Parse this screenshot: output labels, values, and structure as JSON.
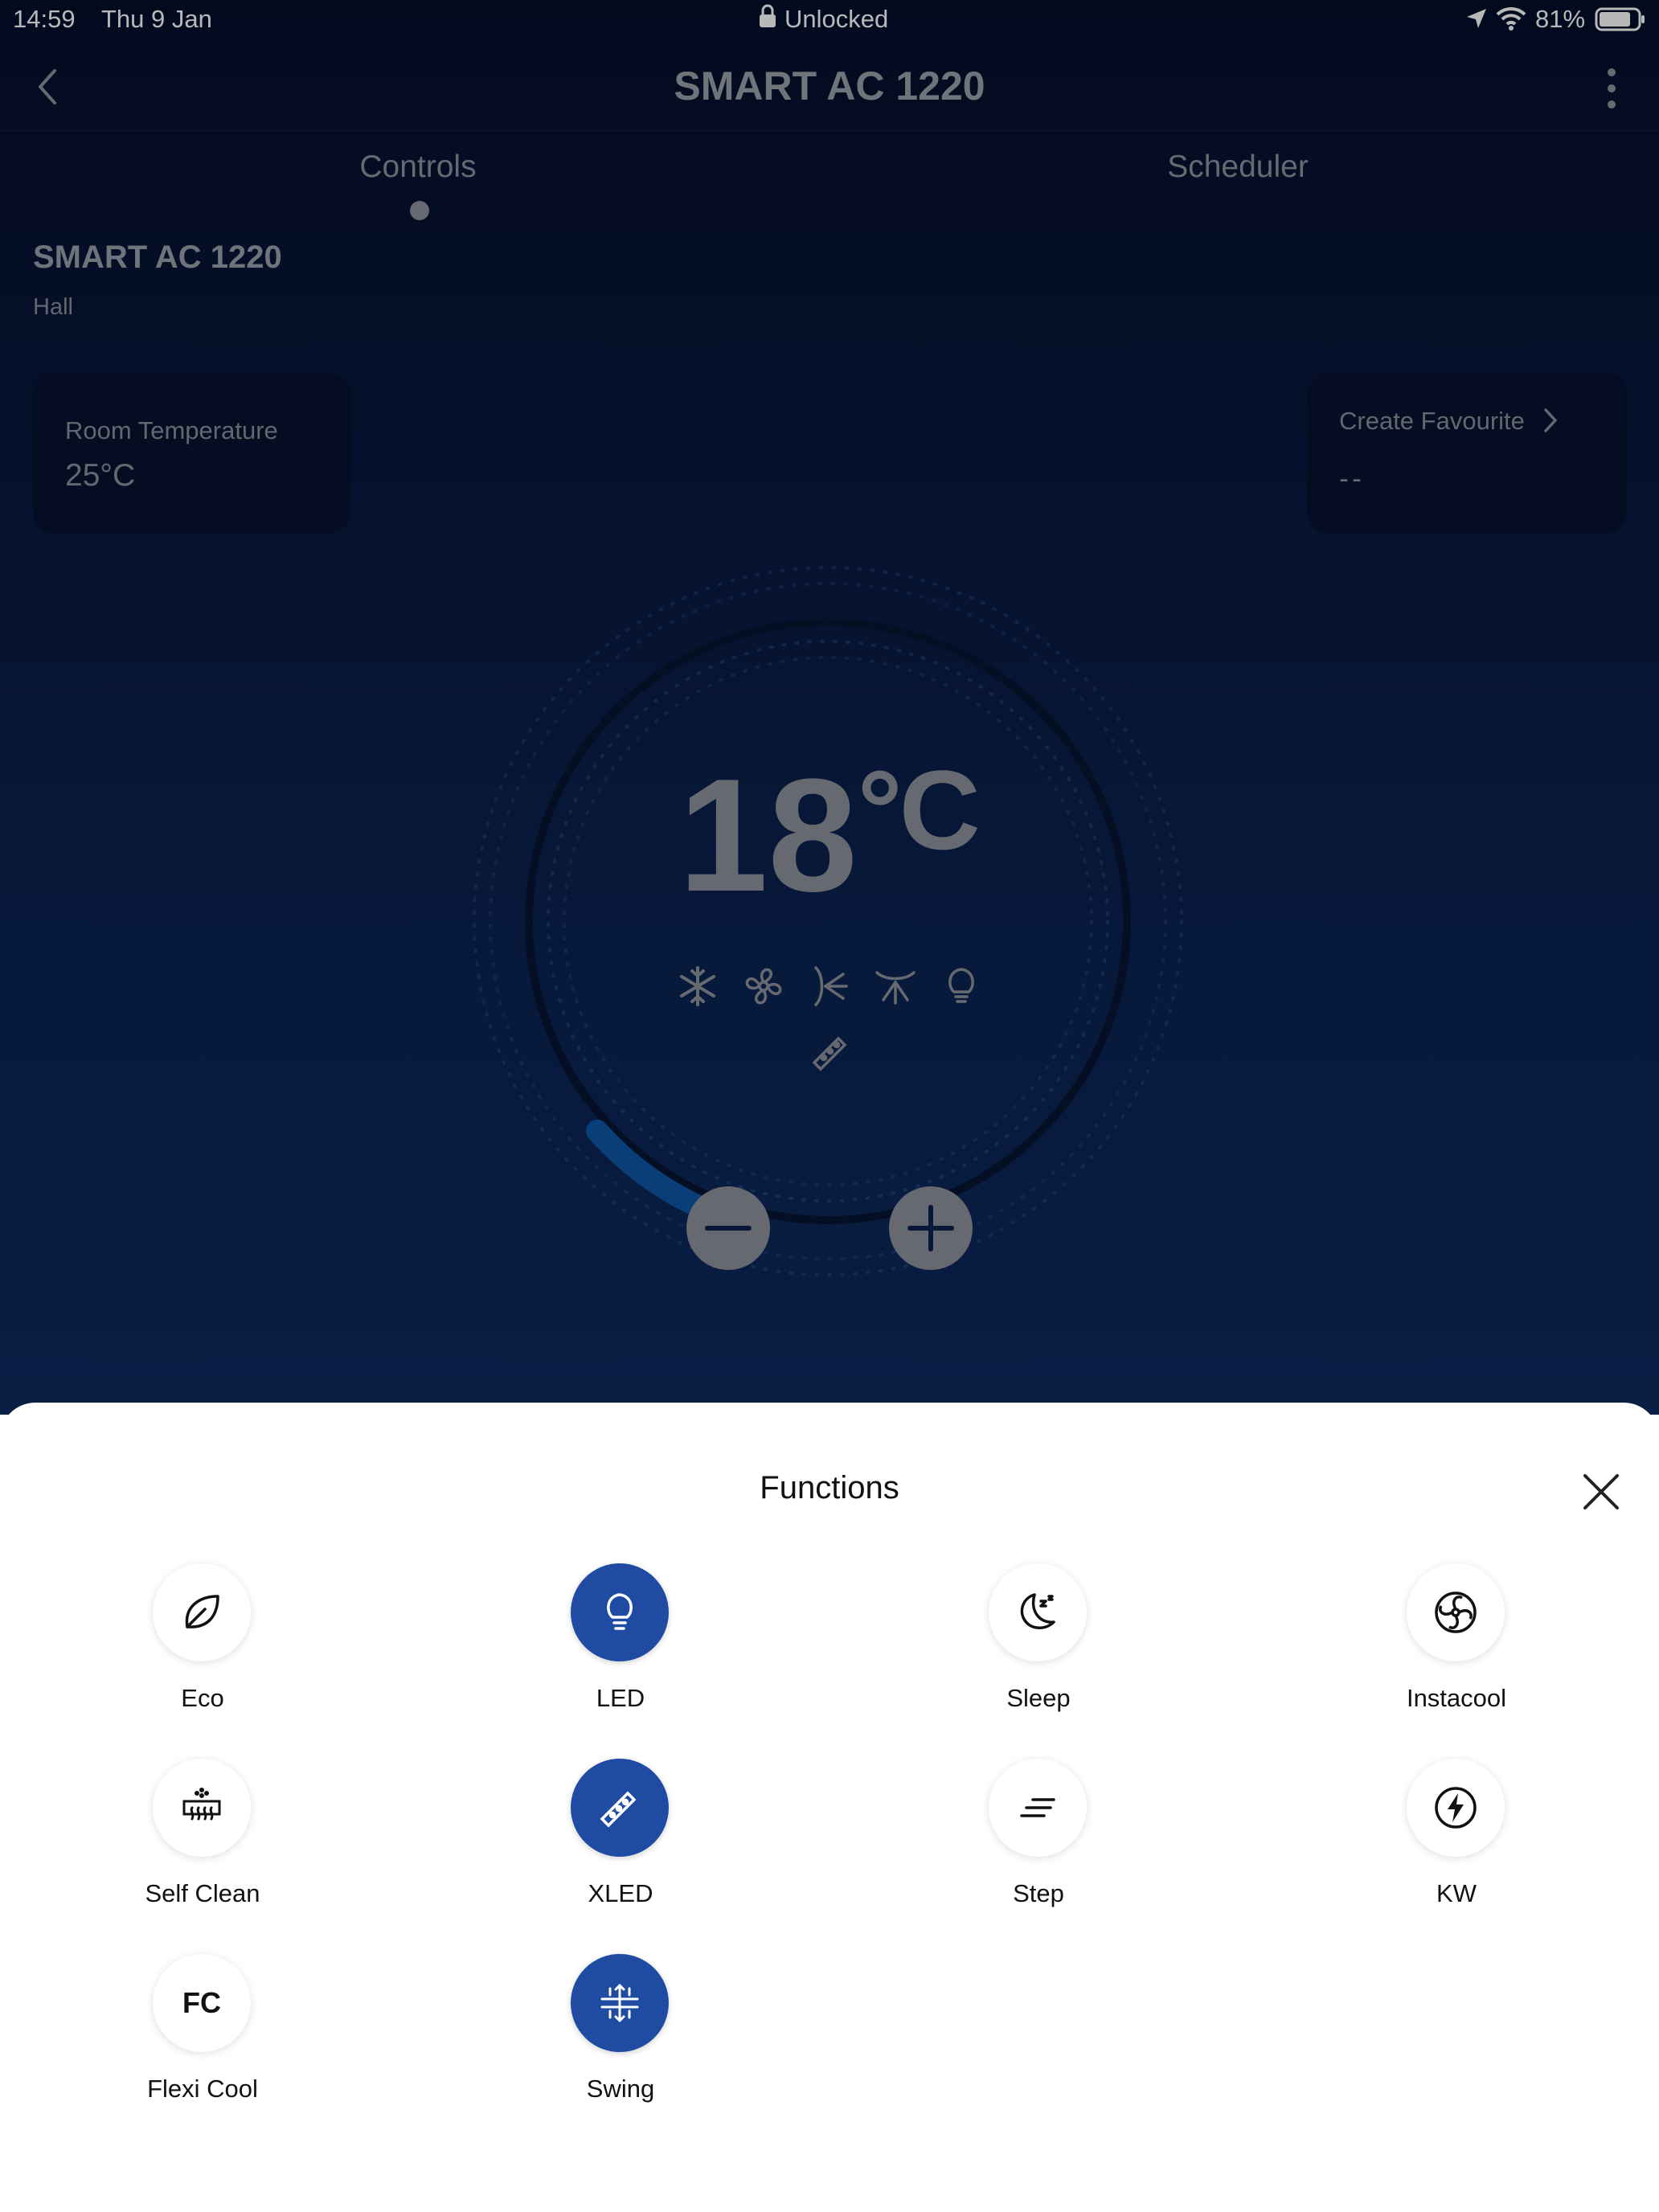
{
  "status_bar": {
    "time": "14:59",
    "date": "Thu 9 Jan",
    "lock_label": "Unlocked",
    "battery": "81%"
  },
  "nav": {
    "title": "SMART AC 1220"
  },
  "tabs": [
    {
      "label": "Controls",
      "active": true
    },
    {
      "label": "Scheduler",
      "active": false
    }
  ],
  "device": {
    "name": "SMART AC 1220",
    "room": "Hall"
  },
  "room_temperature": {
    "label": "Room Temperature",
    "value": "25°C"
  },
  "favourite": {
    "label": "Create Favourite",
    "value": "--"
  },
  "thermostat": {
    "temperature": "18",
    "unit": "°C",
    "mode_icons": [
      "snowflake-icon",
      "fan-icon",
      "swing-horizontal-icon",
      "swing-vertical-icon",
      "bulb-icon",
      "xled-icon"
    ]
  },
  "functions": {
    "title": "Functions",
    "items": [
      {
        "label": "Eco",
        "icon": "leaf-icon",
        "active": false
      },
      {
        "label": "LED",
        "icon": "bulb-icon",
        "active": true
      },
      {
        "label": "Sleep",
        "icon": "moon-icon",
        "active": false
      },
      {
        "label": "Instacool",
        "icon": "fan-icon",
        "active": false
      },
      {
        "label": "Self Clean",
        "icon": "self-clean-icon",
        "active": false
      },
      {
        "label": "XLED",
        "icon": "xled-icon",
        "active": true
      },
      {
        "label": "Step",
        "icon": "step-icon",
        "active": false
      },
      {
        "label": "KW",
        "icon": "bolt-icon",
        "active": false
      },
      {
        "label": "Flexi Cool",
        "icon": "fc-icon",
        "icon_text": "FC",
        "active": false
      },
      {
        "label": "Swing",
        "icon": "swing-icon",
        "active": true
      }
    ]
  },
  "colors": {
    "accent": "#1f4ba3",
    "dial_arc": "#0d57a8"
  }
}
